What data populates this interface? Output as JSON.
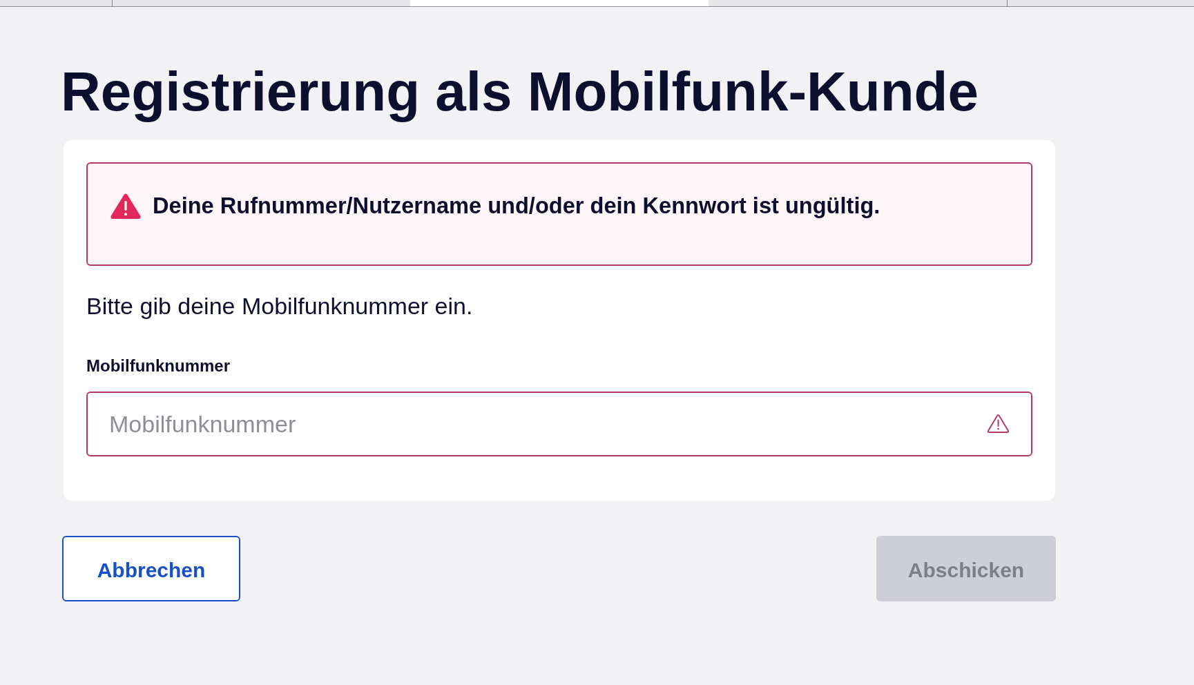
{
  "browser_tabs": [
    {
      "selected": false
    },
    {
      "selected": false
    },
    {
      "selected": true
    },
    {
      "selected": false
    },
    {
      "selected": false
    }
  ],
  "page": {
    "title": "Registrierung als Mobilfunk-Kunde"
  },
  "form": {
    "alert": {
      "kind": "error",
      "message": "Deine Rufnummer/Nutzername und/oder dein Kennwort ist ungültig."
    },
    "instruction": "Bitte gib deine Mobilfunknummer ein.",
    "fields": [
      {
        "label": "Mobilfunknummer",
        "placeholder": "Mobilfunknummer",
        "invalid": true
      }
    ]
  },
  "buttons": [
    {
      "label": "Abbrechen",
      "kind": "secondary",
      "disabled": false
    },
    {
      "label": "Abschicken",
      "kind": "primary",
      "disabled": true
    }
  ]
}
